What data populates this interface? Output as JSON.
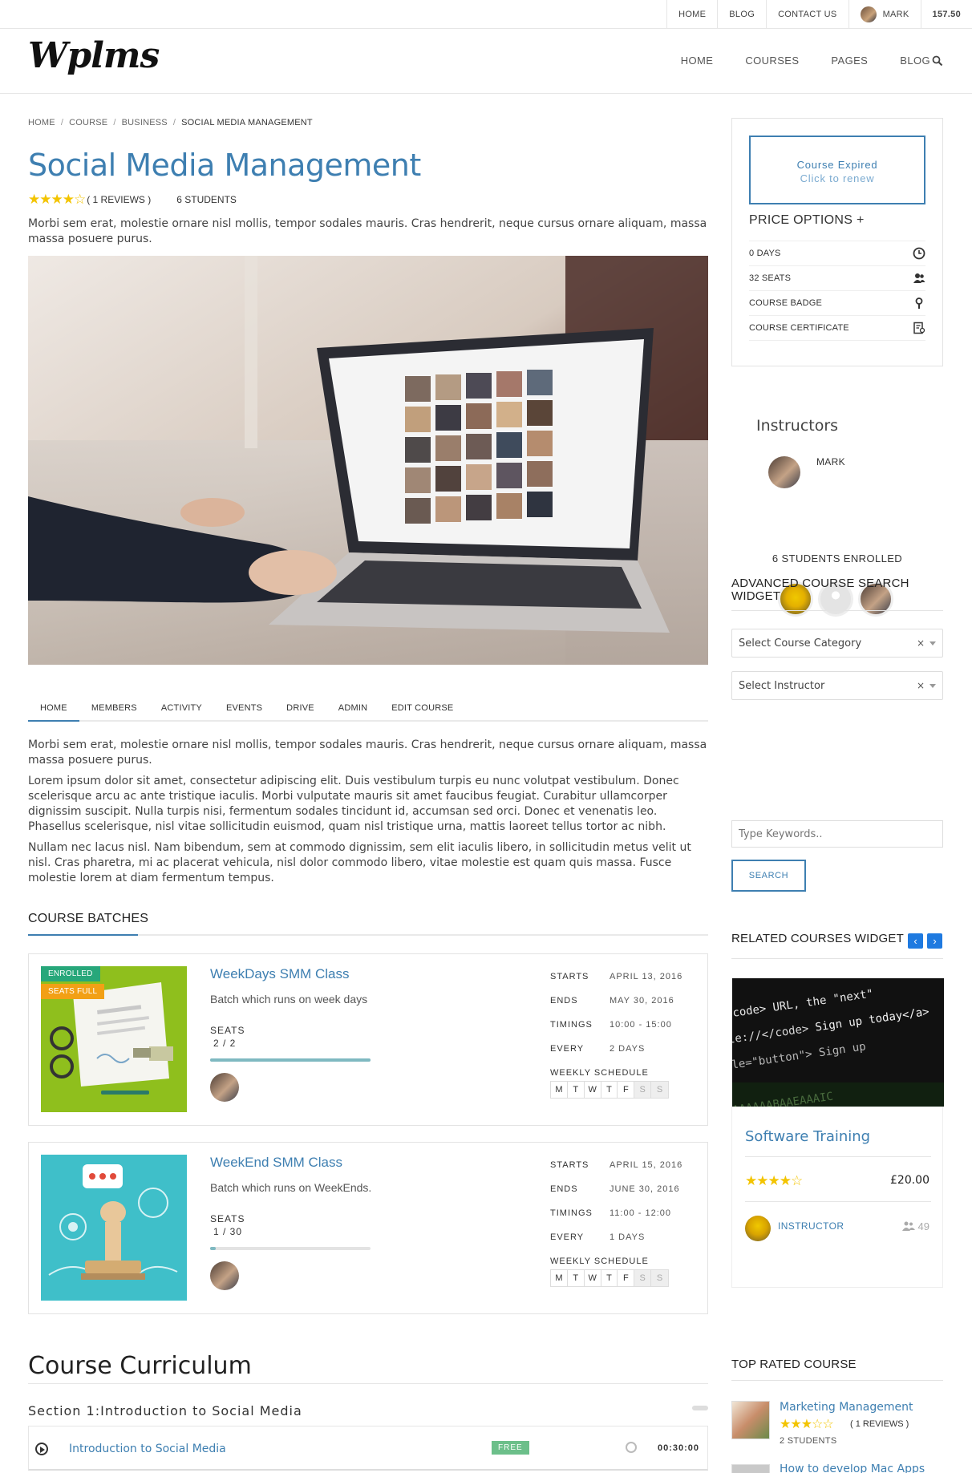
{
  "topbar": {
    "links": [
      "HOME",
      "BLOG",
      "CONTACT US"
    ],
    "user": "MARK",
    "credits": "157.50"
  },
  "header": {
    "logo": "Wplms",
    "nav": [
      "HOME",
      "COURSES",
      "PAGES",
      "BLOG"
    ]
  },
  "breadcrumb": [
    "HOME",
    "COURSE",
    "BUSINESS",
    "SOCIAL MEDIA MANAGEMENT"
  ],
  "course": {
    "title": "Social Media Management",
    "rating": 4,
    "reviews": "( 1 REVIEWS )",
    "students": "6 STUDENTS",
    "intro": "Morbi sem erat, molestie ornare nisl mollis, tempor sodales mauris. Cras hendrerit, neque cursus ornare aliquam, massa massa posuere purus."
  },
  "tabs": [
    "HOME",
    "MEMBERS",
    "ACTIVITY",
    "EVENTS",
    "DRIVE",
    "ADMIN",
    "EDIT COURSE"
  ],
  "description": [
    "Morbi sem erat, molestie ornare nisl mollis, tempor sodales mauris. Cras hendrerit, neque cursus ornare aliquam, massa massa posuere purus.",
    "Lorem ipsum dolor sit amet, consectetur adipiscing elit. Duis vestibulum turpis eu nunc volutpat vestibulum. Donec scelerisque arcu ac ante tristique iaculis. Morbi vulputate mauris sit amet faucibus feugiat. Curabitur ullamcorper dignissim suscipit. Nulla turpis nisi, fermentum sodales tincidunt id, accumsan sed orci. Donec et venenatis leo. Phasellus scelerisque, nisl vitae sollicitudin euismod, quam nisl tristique urna, mattis laoreet tellus tortor ac nibh.",
    "Nullam nec lacus nisl. Nam bibendum, sem at commodo dignissim, sem elit iaculis libero, in sollicitudin metus velit ut nisl. Cras pharetra, mi ac placerat vehicula, nisl dolor commodo libero, vitae molestie est quam quis massa. Fusce molestie lorem at diam fermentum tempus."
  ],
  "batches_heading": "COURSE BATCHES",
  "batches": [
    {
      "name": "WeekDays SMM Class",
      "desc": "Batch which runs on week days",
      "badges": [
        "ENROLLED",
        "SEATS FULL"
      ],
      "seats_label": "SEATS",
      "seats": "2 / 2",
      "fill": 1.0,
      "info": [
        {
          "k": "STARTS",
          "v": "APRIL 13, 2016"
        },
        {
          "k": "ENDS",
          "v": "MAY 30, 2016"
        },
        {
          "k": "TIMINGS",
          "v": "10:00 - 15:00"
        },
        {
          "k": "EVERY",
          "v": "2 DAYS"
        }
      ],
      "schedule_label": "WEEKLY SCHEDULE",
      "days": [
        "M",
        "T",
        "W",
        "T",
        "F",
        "S",
        "S"
      ]
    },
    {
      "name": "WeekEnd SMM Class",
      "desc": "Batch which runs on WeekEnds.",
      "badges": [],
      "seats_label": "SEATS",
      "seats": "1 / 30",
      "fill": 0.033,
      "info": [
        {
          "k": "STARTS",
          "v": "APRIL 15, 2016"
        },
        {
          "k": "ENDS",
          "v": "JUNE 30, 2016"
        },
        {
          "k": "TIMINGS",
          "v": "11:00 - 12:00"
        },
        {
          "k": "EVERY",
          "v": "1 DAYS"
        }
      ],
      "schedule_label": "WEEKLY SCHEDULE",
      "days": [
        "M",
        "T",
        "W",
        "T",
        "F",
        "S",
        "S"
      ]
    }
  ],
  "curriculum": {
    "title": "Course Curriculum",
    "section": "Section 1:Introduction to Social Media",
    "unit": "Introduction to Social Media",
    "free": "FREE",
    "duration": "00:30:00"
  },
  "sidebar": {
    "expired": "Course Expired",
    "renew": "Click to renew",
    "price_options": "PRICE OPTIONS +",
    "price_items": [
      "0 DAYS",
      "32 SEATS",
      "COURSE BADGE",
      "COURSE CERTIFICATE"
    ],
    "instructors_heading": "Instructors",
    "instructor": "MARK",
    "enrolled": "6 STUDENTS ENROLLED",
    "search_heading": "ADVANCED COURSE SEARCH WIDGET",
    "category_select": "Select Course Category",
    "instructor_select": "Select Instructor",
    "keywords_placeholder": "Type Keywords..",
    "search_button": "SEARCH",
    "related_heading": "RELATED COURSES WIDGET",
    "related": {
      "title": "Software Training",
      "rating": 4,
      "price": "£20.00",
      "instructor": "INSTRUCTOR",
      "students": "49"
    },
    "top_heading": "TOP RATED COURSE",
    "top_courses": [
      {
        "title": "Marketing Management",
        "reviews": "( 1 REVIEWS )",
        "students": "2 STUDENTS",
        "rating": 3
      },
      {
        "title": "How to develop Mac Apps"
      }
    ]
  }
}
